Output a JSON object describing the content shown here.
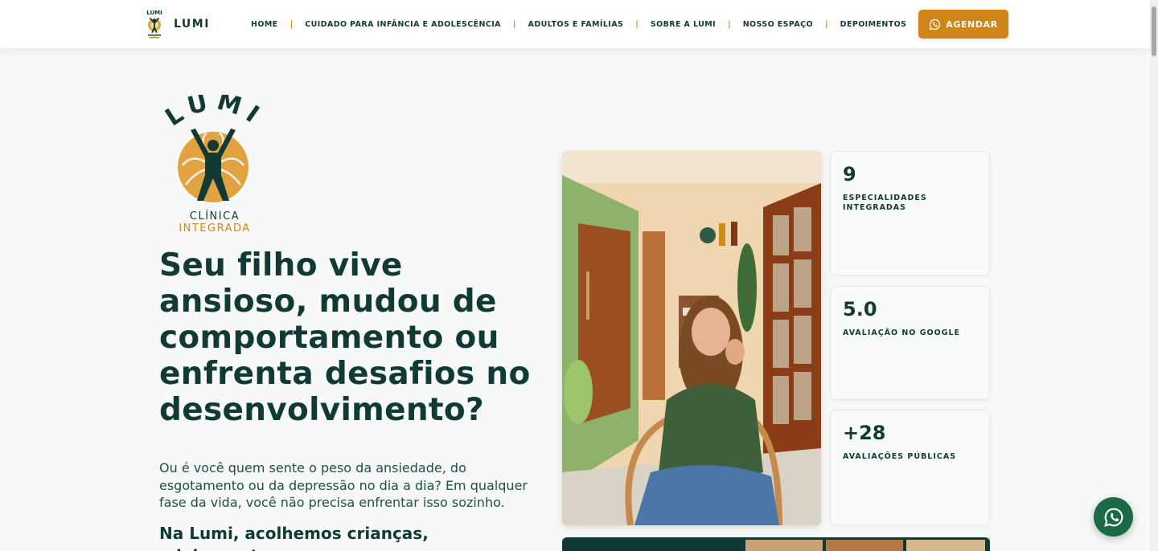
{
  "header": {
    "brand_name": "LUMI",
    "nav": [
      {
        "label": "HOME"
      },
      {
        "label": "CUIDADO PARA INFÂNCIA E ADOLESCÊNCIA"
      },
      {
        "label": "ADULTOS E FAMÍLIAS"
      },
      {
        "label": "SOBRE A LUMI"
      },
      {
        "label": "NOSSO ESPAÇO"
      },
      {
        "label": "DEPOIMENTOS"
      }
    ],
    "separator": "|",
    "cta_label": "AGENDAR",
    "cta_icon": "whatsapp-icon"
  },
  "logo": {
    "word": "LUMI",
    "line1": "CLÍNICA",
    "line2": "INTEGRADA"
  },
  "hero": {
    "headline": "Seu filho vive ansioso, mudou de comportamento ou enfrenta desafios no desenvolvimento?",
    "intro": "Ou é você quem sente o peso da ansiedade, do esgotamento ou da depressão no dia a dia? Em qualquer fase da vida, você não precisa enfrentar isso sozinho.",
    "subhead": "Na Lumi, acolhemos crianças, adolescentes,"
  },
  "stats": [
    {
      "value": "9",
      "label": "ESPECIALIDADES INTEGRADAS"
    },
    {
      "value": "5.0",
      "label": "AVALIAÇÃO NO GOOGLE"
    },
    {
      "value": "+28",
      "label": "AVALIAÇÕES PÚBLICAS"
    }
  ],
  "floating_button": {
    "icon": "whatsapp-icon"
  },
  "colors": {
    "primary": "#103a33",
    "accent": "#cf8517",
    "background": "#f7f9f8",
    "whatsapp": "#1a6b45"
  }
}
